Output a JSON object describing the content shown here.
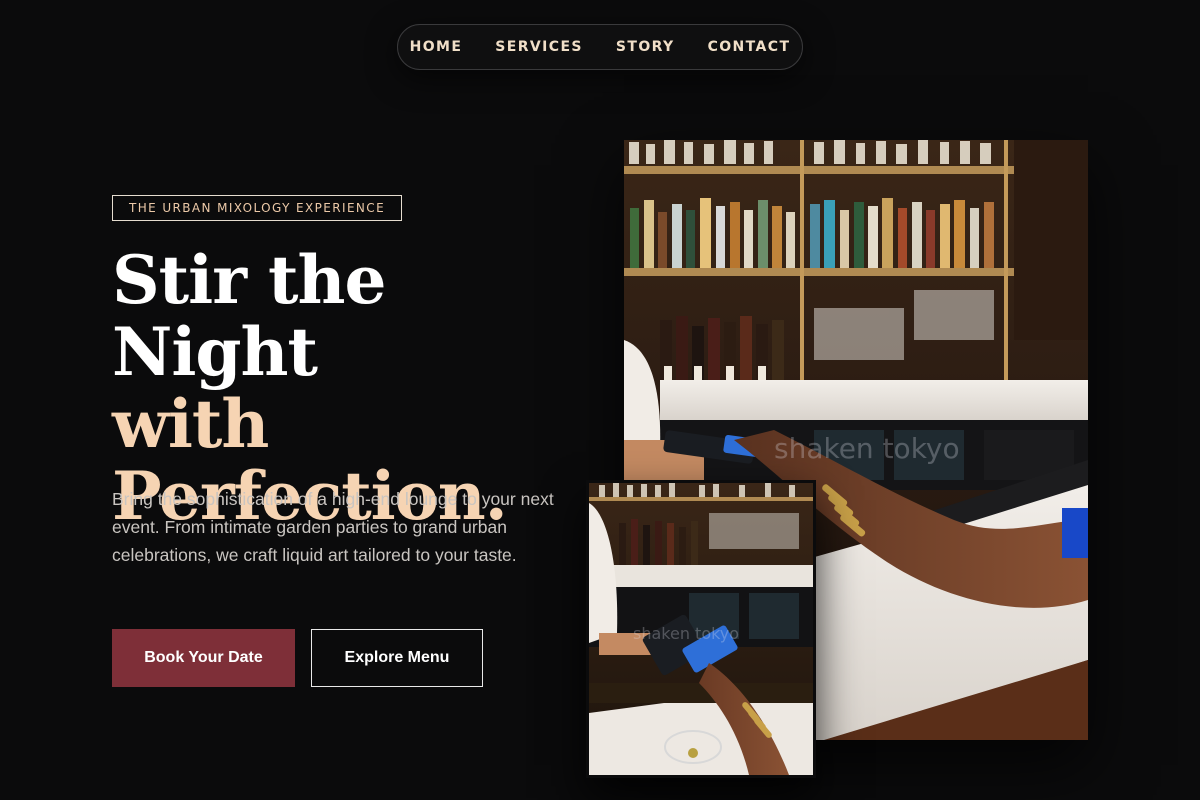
{
  "nav": {
    "items": [
      {
        "label": "HOME"
      },
      {
        "label": "SERVICES"
      },
      {
        "label": "STORY"
      },
      {
        "label": "CONTACT"
      }
    ]
  },
  "hero": {
    "eyebrow": "THE URBAN MIXOLOGY EXPERIENCE",
    "headline_line1": "Stir the Night",
    "headline_line2": "with",
    "headline_line3": "Perfection.",
    "lead": "Bring the sophistication of a high-end lounge to your next event. From intimate garden parties to grand urban celebrations, we craft liquid art tailored to your taste.",
    "primary_cta": "Book Your Date",
    "secondary_cta": "Explore Menu"
  },
  "images": {
    "large_watermark": "shaken tokyo",
    "small_watermark": "shaken tokyo"
  },
  "colors": {
    "background": "#0b0b0c",
    "accent_peach": "#f6d4b3",
    "primary_button": "#7e2f38"
  }
}
